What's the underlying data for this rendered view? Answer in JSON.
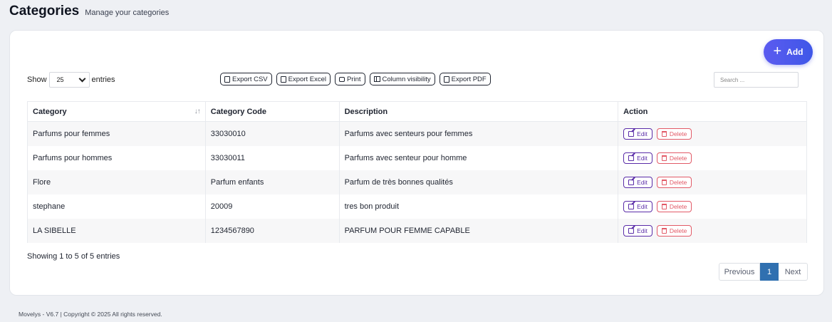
{
  "header": {
    "title": "Categories",
    "subtitle": "Manage your categories"
  },
  "toolbar": {
    "add_label": "Add",
    "show_label": "Show",
    "entries_label": "entries",
    "page_size": "25",
    "exports": [
      "Export CSV",
      "Export Excel",
      "Print",
      "Column visibility",
      "Export PDF"
    ],
    "search_placeholder": "Search ..."
  },
  "table": {
    "columns": [
      "Category",
      "Category Code",
      "Description",
      "Action"
    ],
    "rows": [
      {
        "category": "Parfums pour femmes",
        "code": "33030010",
        "description": "Parfums avec senteurs pour femmes"
      },
      {
        "category": "Parfums pour hommes",
        "code": "33030011",
        "description": "Parfums avec senteur pour homme"
      },
      {
        "category": "Flore",
        "code": "Parfum enfants",
        "description": "Parfum de très bonnes qualités"
      },
      {
        "category": "stephane",
        "code": "20009",
        "description": "tres bon produit"
      },
      {
        "category": "LA SIBELLE",
        "code": "1234567890",
        "description": "PARFUM POUR FEMME CAPABLE"
      }
    ],
    "edit_label": "Edit",
    "delete_label": "Delete"
  },
  "info": "Showing 1 to 5 of 5 entries",
  "pagination": {
    "previous": "Previous",
    "current": "1",
    "next": "Next"
  },
  "footer": "Movelys - V6.7 | Copyright © 2025 All rights reserved.",
  "colors": {
    "accent": "#4a58ec",
    "edit": "#5a2ca8",
    "delete": "#e25a67",
    "page_active": "#3070b0"
  }
}
